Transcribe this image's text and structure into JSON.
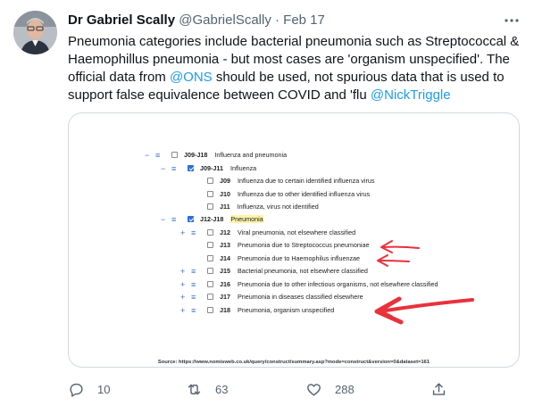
{
  "tweet": {
    "author_name": "Dr Gabriel Scally",
    "handle": "@GabrielScally",
    "separator": "·",
    "date": "Feb 17",
    "text_part1": "Pneumonia categories include bacterial pneumonia such as Streptococcal & Haemophillus pneumonia - but most cases are 'organism unspecified'. The official data from ",
    "mention_ons": "@ONS",
    "text_part2": " should be used, not spurious data that is used to support false equivalence between COVID and 'flu ",
    "mention_nick": "@NickTriggle"
  },
  "image": {
    "rows": [
      {
        "code": "J09-J18",
        "label": "Influenza and pneumonia",
        "checked": false,
        "highlight": false
      },
      {
        "code": "J09-J11",
        "label": "Influenza",
        "checked": true,
        "highlight": false
      },
      {
        "code": "J09",
        "label": "Influenza due to certain identified influenza virus",
        "checked": false,
        "highlight": false
      },
      {
        "code": "J10",
        "label": "Influenza due to other identified influenza virus",
        "checked": false,
        "highlight": false
      },
      {
        "code": "J11",
        "label": "Influenza, virus not identified",
        "checked": false,
        "highlight": false
      },
      {
        "code": "J12-J18",
        "label": "Pneumonia",
        "checked": true,
        "highlight": true
      },
      {
        "code": "J12",
        "label": "Viral pneumonia, not elsewhere classified",
        "checked": false,
        "highlight": false
      },
      {
        "code": "J13",
        "label": "Pneumonia due to Streptococcus pneumoniae",
        "checked": false,
        "highlight": false
      },
      {
        "code": "J14",
        "label": "Pneumonia due to Haemophilus influenzae",
        "checked": false,
        "highlight": false
      },
      {
        "code": "J15",
        "label": "Bacterial pneumonia, not elsewhere classified",
        "checked": false,
        "highlight": false
      },
      {
        "code": "J16",
        "label": "Pneumonia due to other infectious organisms, not elsewhere classified",
        "checked": false,
        "highlight": false
      },
      {
        "code": "J17",
        "label": "Pneumonia in diseases classified elsewhere",
        "checked": false,
        "highlight": false
      },
      {
        "code": "J18",
        "label": "Pneumonia, organism unspecified",
        "checked": false,
        "highlight": false
      }
    ],
    "source": "Source: https://www.nomisweb.co.uk/query/construct/summary.asp?mode=construct&version=0&dataset=161",
    "expand_glyph": "+",
    "collapse_glyph": "−",
    "menu_glyph": "≡"
  },
  "actions": {
    "reply_count": "10",
    "retweet_count": "63",
    "like_count": "288"
  },
  "colors": {
    "link": "#1d9bf0",
    "muted": "#536471",
    "annotation_arrow": "#e8323c"
  },
  "icons": [
    "avatar",
    "more-icon",
    "reply-icon",
    "retweet-icon",
    "like-icon",
    "share-icon"
  ]
}
